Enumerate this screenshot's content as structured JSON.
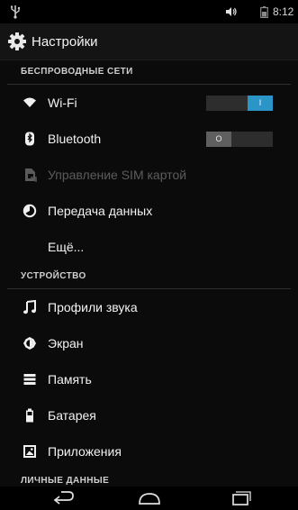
{
  "status_bar": {
    "time": "8:12",
    "icons": [
      "usb-icon",
      "volume-icon",
      "battery-icon"
    ]
  },
  "action_bar": {
    "icon": "gear-icon",
    "title": "Настройки"
  },
  "sections": {
    "wireless": {
      "header": "БЕСПРОВОДНЫЕ СЕТИ",
      "wifi": {
        "label": "Wi-Fi",
        "icon": "wifi-icon",
        "toggle": "I",
        "enabled": true
      },
      "bluetooth": {
        "label": "Bluetooth",
        "icon": "bluetooth-icon",
        "toggle": "O",
        "enabled": false
      },
      "sim": {
        "label": "Управление SIM картой",
        "icon": "sim-card-icon",
        "disabled": true
      },
      "data": {
        "label": "Передача данных",
        "icon": "data-usage-icon"
      },
      "more": {
        "label": "Ещё..."
      }
    },
    "device": {
      "header": "УСТРОЙСТВО",
      "sound": {
        "label": "Профили звука",
        "icon": "music-note-icon"
      },
      "display": {
        "label": "Экран",
        "icon": "brightness-icon"
      },
      "storage": {
        "label": "Память",
        "icon": "storage-icon"
      },
      "battery": {
        "label": "Батарея",
        "icon": "battery-icon"
      },
      "apps": {
        "label": "Приложения",
        "icon": "apps-icon"
      }
    },
    "personal": {
      "header": "ЛИЧНЫЕ ДАННЫЕ"
    }
  },
  "nav_bar": {
    "icons": [
      "back-icon",
      "home-icon",
      "recent-apps-icon"
    ]
  },
  "colors": {
    "accent": "#2b95c8",
    "background": "#0b0b0b",
    "text": "#f2f2f2",
    "disabled_text": "#5c5c5c"
  }
}
